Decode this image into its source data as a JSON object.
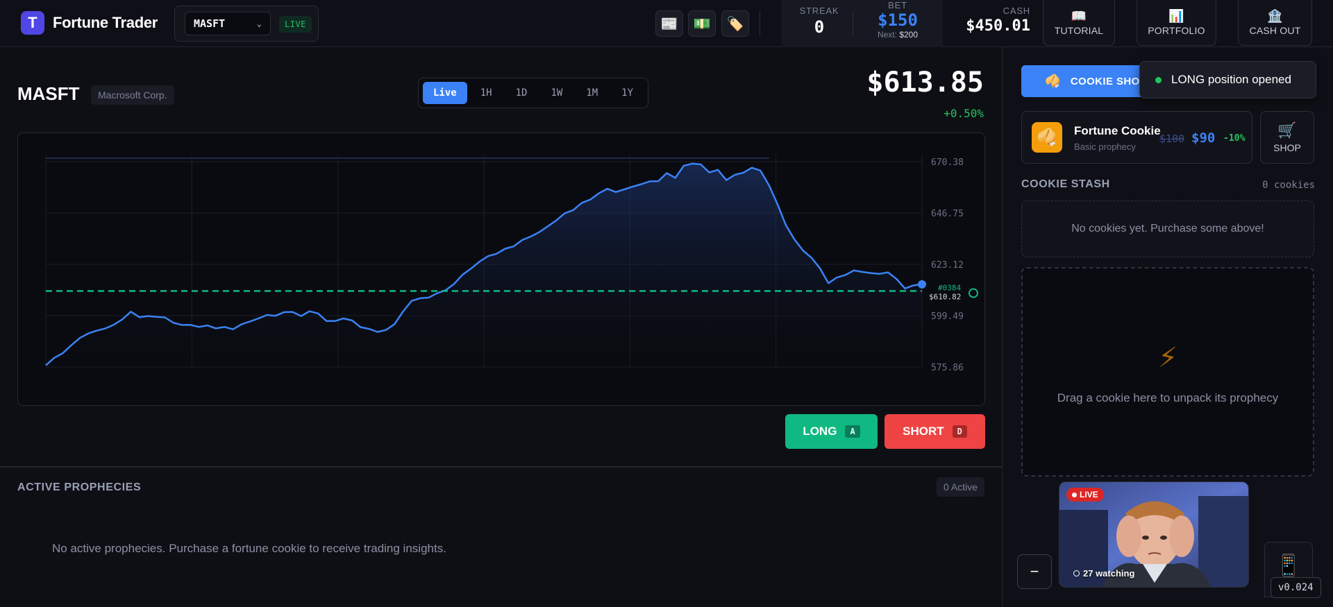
{
  "app": {
    "name": "Fortune Trader",
    "logo_letter": "T"
  },
  "ticker": {
    "selected": "MASFT",
    "live_label": "LIVE"
  },
  "toolbar_icons": [
    "newspaper-icon",
    "money-icon",
    "tag-icon"
  ],
  "stats": {
    "streak_label": "STREAK",
    "streak_value": "0",
    "bet_label": "BET",
    "bet_value": "$150",
    "bet_next_prefix": "Next:",
    "bet_next_value": "$200",
    "cash_label": "CASH",
    "cash_value": "$450.01"
  },
  "nav": {
    "tutorial": "TUTORIAL",
    "portfolio": "PORTFOLIO",
    "cash_out": "CASH OUT"
  },
  "stock": {
    "symbol": "MASFT",
    "company": "Macrosoft Corp.",
    "price": "$613.85",
    "change": "+0.50%"
  },
  "timeframes": [
    "Live",
    "1H",
    "1D",
    "1W",
    "1M",
    "1Y"
  ],
  "timeframe_active": "Live",
  "chart_data": {
    "type": "line",
    "y_ticks": [
      "670.38",
      "646.75",
      "623.12",
      "599.49",
      "575.86"
    ],
    "ylim": [
      575.86,
      670.38
    ],
    "entry_line": {
      "value": 610.82,
      "label": "$610.82",
      "tag": "#0384",
      "color": "#10b981"
    },
    "series_color": "#3b82f6",
    "series": [
      {
        "values": [
          576.6,
          580.1,
          582.2,
          585.9,
          589.2,
          591.3,
          592.6,
          593.6,
          595.3,
          597.8,
          601.3,
          598.8,
          599.3,
          598.9,
          598.7,
          596.2,
          595.2,
          595.2,
          594.3,
          595.0,
          593.6,
          594.3,
          593.2,
          595.5,
          596.8,
          598.2,
          599.8,
          599.4,
          601.1,
          601.2,
          599.3,
          601.5,
          600.5,
          597.0,
          597.0,
          598.2,
          597.3,
          594.2,
          593.4,
          592.0,
          592.9,
          595.6,
          601.4,
          606.3,
          607.5,
          607.8,
          609.8,
          611.2,
          614.1,
          618.4,
          621.2,
          624.4,
          626.9,
          628.0,
          630.3,
          631.4,
          634.3,
          635.9,
          637.9,
          640.6,
          643.3,
          646.6,
          648.1,
          651.4,
          652.9,
          655.8,
          657.9,
          656.4,
          657.6,
          658.9,
          660.0,
          661.3,
          661.4,
          665.1,
          662.9,
          668.5,
          669.5,
          669.1,
          665.4,
          666.6,
          661.9,
          664.3,
          665.3,
          667.6,
          666.3,
          659.6,
          650.9,
          641.1,
          634.6,
          629.5,
          626.2,
          621.3,
          614.4,
          617.1,
          618.2,
          620.3,
          619.6,
          619.1,
          618.7,
          619.4,
          616.4,
          612.0,
          613.4,
          613.9
        ]
      }
    ]
  },
  "actions": {
    "long_label": "LONG",
    "long_key": "A",
    "short_label": "SHORT",
    "short_key": "D"
  },
  "prophecies": {
    "title": "ACTIVE PROPHECIES",
    "count": "0 Active",
    "empty": "No active prophecies. Purchase a fortune cookie to receive trading insights."
  },
  "sidebar": {
    "cookie_shop_label": "COOKIE SHOP",
    "toast": "LONG position opened",
    "cookie": {
      "name": "Fortune Cookie",
      "desc": "Basic prophecy",
      "price_old": "$100",
      "price_new": "$90",
      "discount": "-10%"
    },
    "shop_label": "SHOP",
    "stash_title": "COOKIE STASH",
    "stash_count": "0 cookies",
    "stash_empty": "No cookies yet. Purchase some above!",
    "drop_text": "Drag a cookie here to unpack its prophecy",
    "stream": {
      "live": "LIVE",
      "watching": "27 watching"
    },
    "minimize": "−",
    "version": "v0.024"
  }
}
